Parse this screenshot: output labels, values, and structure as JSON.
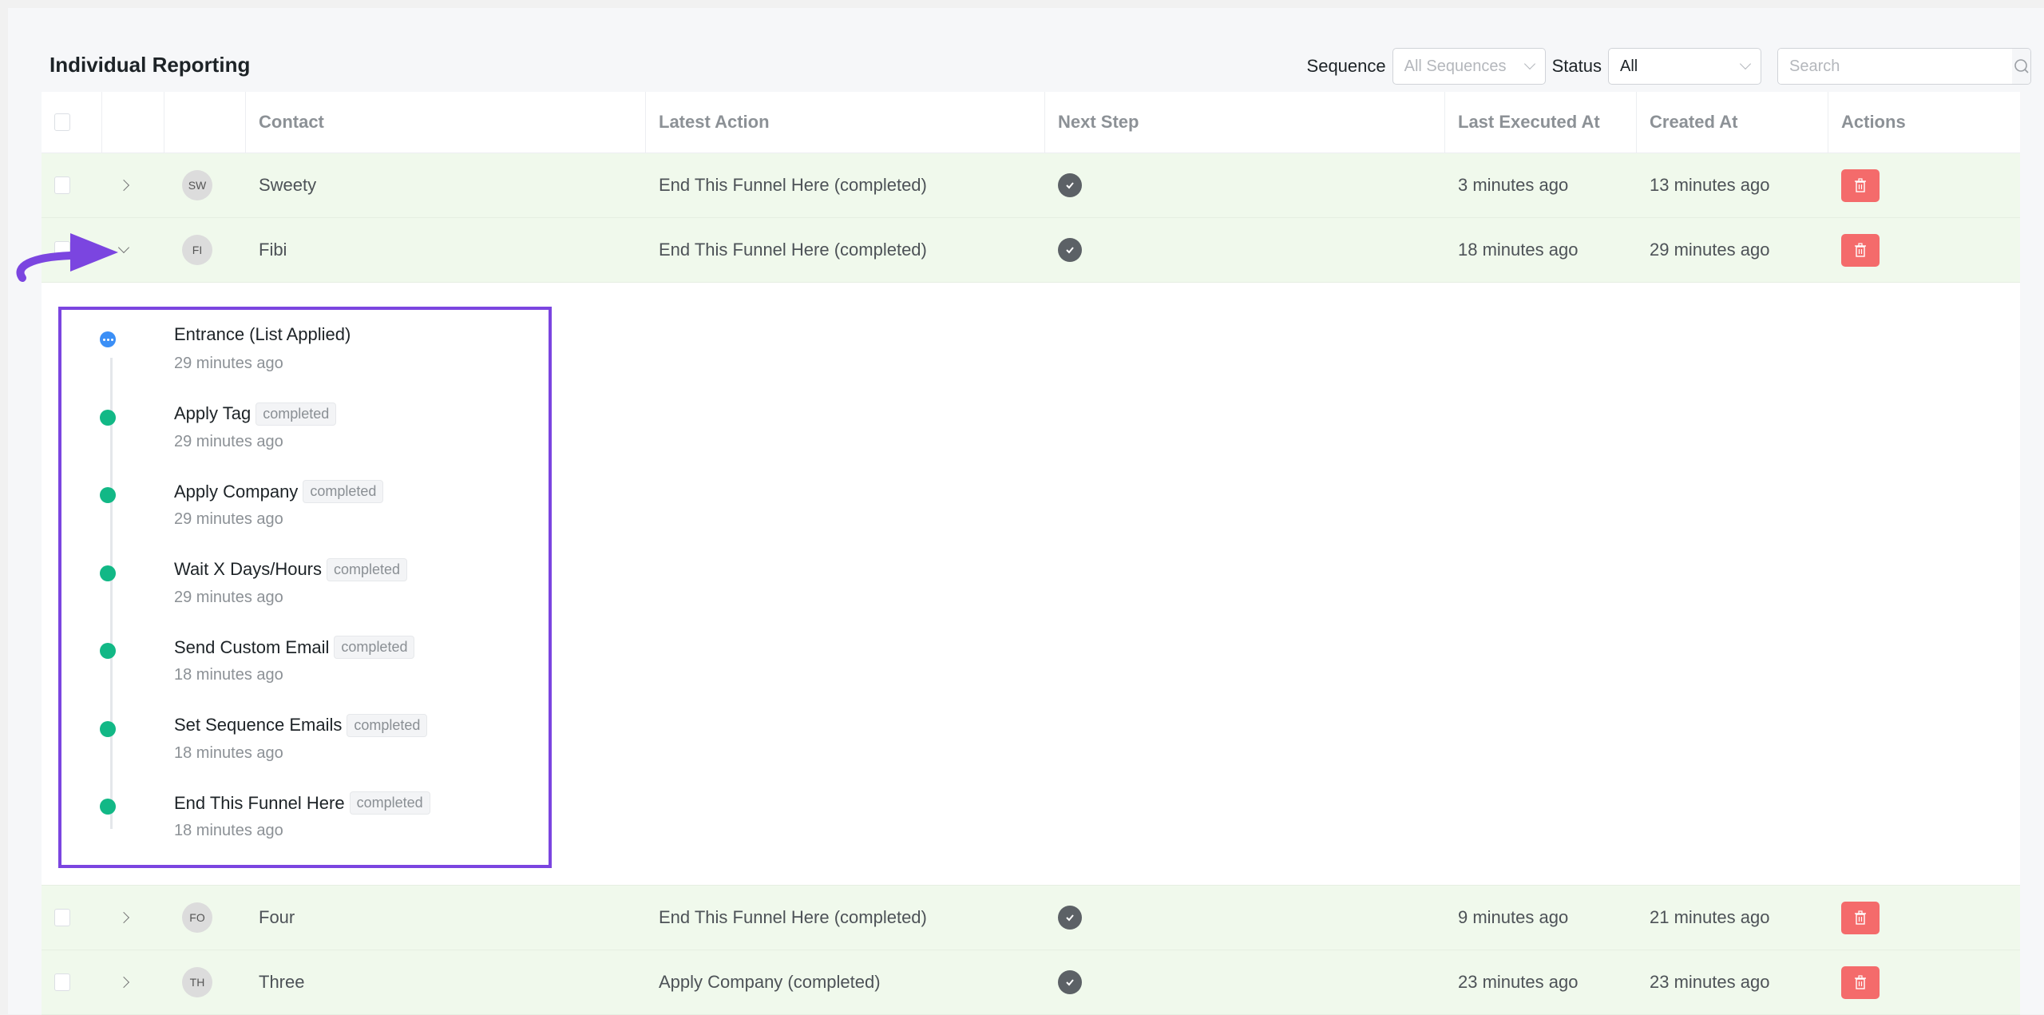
{
  "header": {
    "title": "Individual Reporting",
    "sequence_label": "Sequence",
    "sequence_value": "All Sequences",
    "status_label": "Status",
    "status_value": "All",
    "search_placeholder": "Search"
  },
  "table": {
    "columns": [
      "",
      "",
      "",
      "Contact",
      "Latest Action",
      "Next Step",
      "Last Executed At",
      "Created At",
      "Actions"
    ],
    "rows": [
      {
        "initials": "SW",
        "contact": "Sweety",
        "latest_action": "End This Funnel Here (completed)",
        "next_step": "check-icon",
        "last_executed": "3 minutes ago",
        "created": "13 minutes ago",
        "expanded": false
      },
      {
        "initials": "FI",
        "contact": "Fibi",
        "latest_action": "End This Funnel Here (completed)",
        "next_step": "check-icon",
        "last_executed": "18 minutes ago",
        "created": "29 minutes ago",
        "expanded": true
      },
      {
        "initials": "FO",
        "contact": "Four",
        "latest_action": "End This Funnel Here (completed)",
        "next_step": "check-icon",
        "last_executed": "9 minutes ago",
        "created": "21 minutes ago",
        "expanded": false
      },
      {
        "initials": "TH",
        "contact": "Three",
        "latest_action": "Apply Company (completed)",
        "next_step": "check-icon",
        "last_executed": "23 minutes ago",
        "created": "23 minutes ago",
        "expanded": false
      }
    ]
  },
  "timeline": [
    {
      "title": "Entrance (List Applied)",
      "status": "",
      "time": "29 minutes ago",
      "dot": "blue"
    },
    {
      "title": "Apply Tag",
      "status": "completed",
      "time": "29 minutes ago",
      "dot": "green"
    },
    {
      "title": "Apply Company",
      "status": "completed",
      "time": "29 minutes ago",
      "dot": "green"
    },
    {
      "title": "Wait X Days/Hours",
      "status": "completed",
      "time": "29 minutes ago",
      "dot": "green"
    },
    {
      "title": "Send Custom Email",
      "status": "completed",
      "time": "18 minutes ago",
      "dot": "green"
    },
    {
      "title": "Set Sequence Emails",
      "status": "completed",
      "time": "18 minutes ago",
      "dot": "green"
    },
    {
      "title": "End This Funnel Here",
      "status": "completed",
      "time": "18 minutes ago",
      "dot": "green"
    }
  ],
  "colors": {
    "row_highlight": "#f0f9ec",
    "delete": "#f46b6b",
    "completed_dot": "#12b886",
    "entrance_dot": "#3b8ff6",
    "annotation": "#7b45e0"
  }
}
